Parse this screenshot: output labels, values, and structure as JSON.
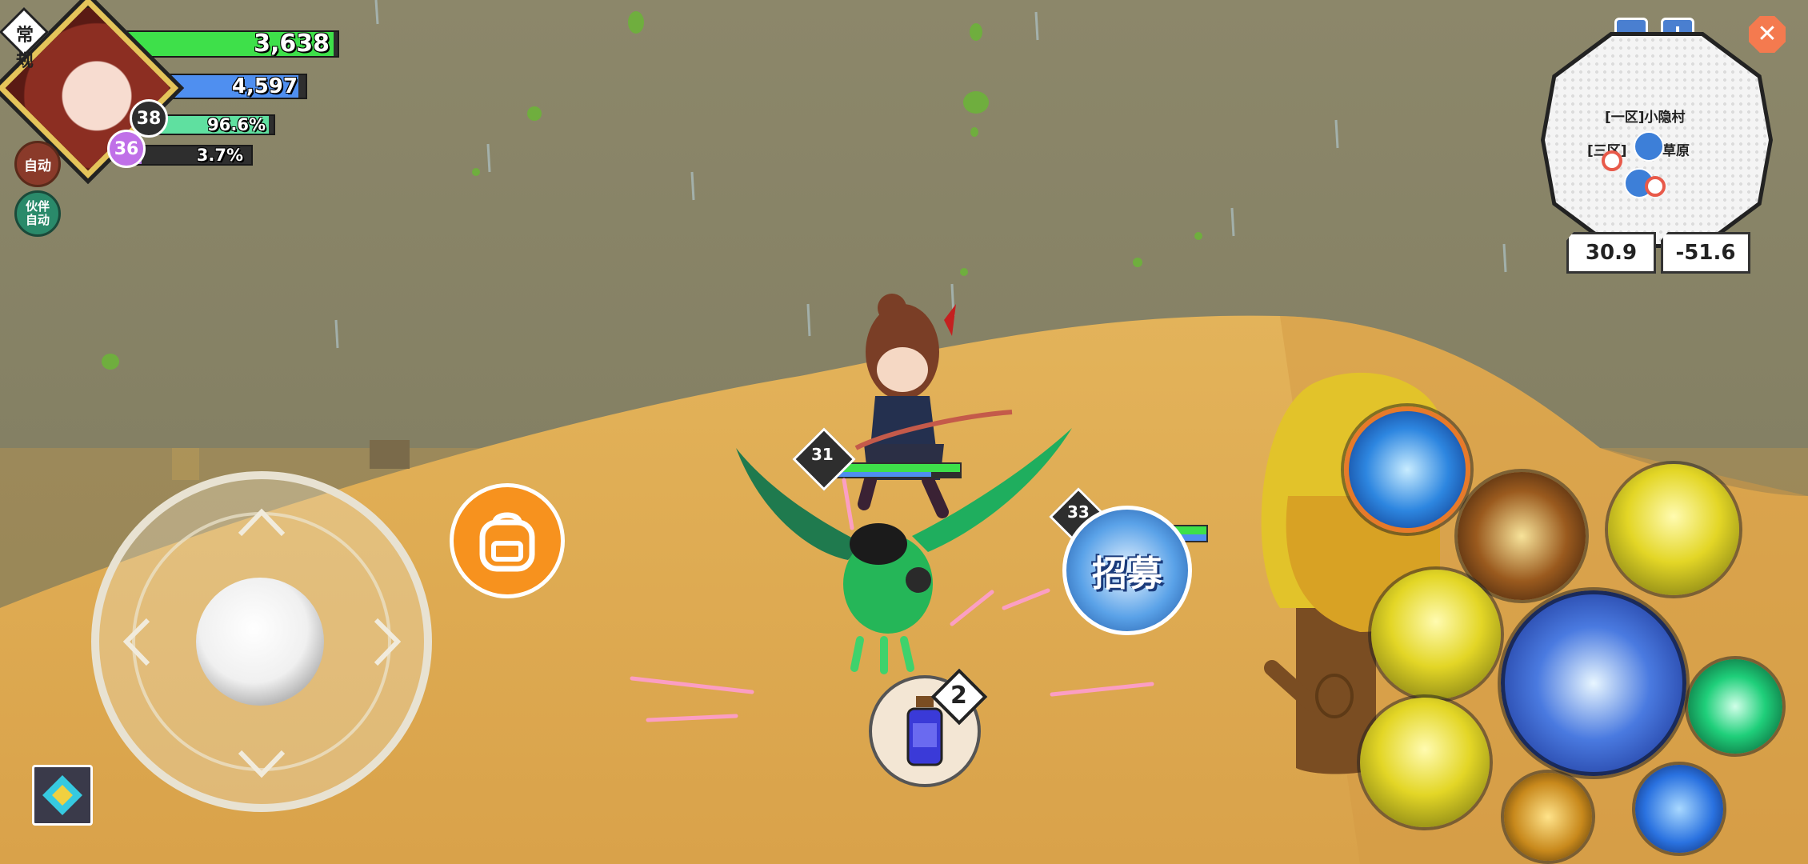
{
  "hud": {
    "mode_label": "常规",
    "hp_value": "3,638",
    "mp_value": "4,597",
    "exp_percent": "96.6%",
    "exp2_percent": "3.7%",
    "player_level": "38",
    "pet_level": "36",
    "auto_label": "自动",
    "partner_auto_label": "伙伴\n自动",
    "hp_fill": 0.98,
    "mp_fill": 0.96,
    "exp_fill": 0.966,
    "exp2_fill": 0.037
  },
  "minimap": {
    "zone_a": "[一区]小隐村",
    "zone_b": "[三区]",
    "zone_b_suffix": "草原",
    "coord_x": "30.9",
    "coord_y": "-51.6"
  },
  "world": {
    "enemy1_level": "31",
    "enemy2_level": "33",
    "recruit_label": "招募",
    "potion_count": "2"
  },
  "colors": {
    "hp": "#3ee04a",
    "mp": "#4f8ff0",
    "exp": "#5fe0a0",
    "exp2": "#b070e0",
    "bag_orange": "#f7921e",
    "close_orange": "#f47a4f"
  }
}
